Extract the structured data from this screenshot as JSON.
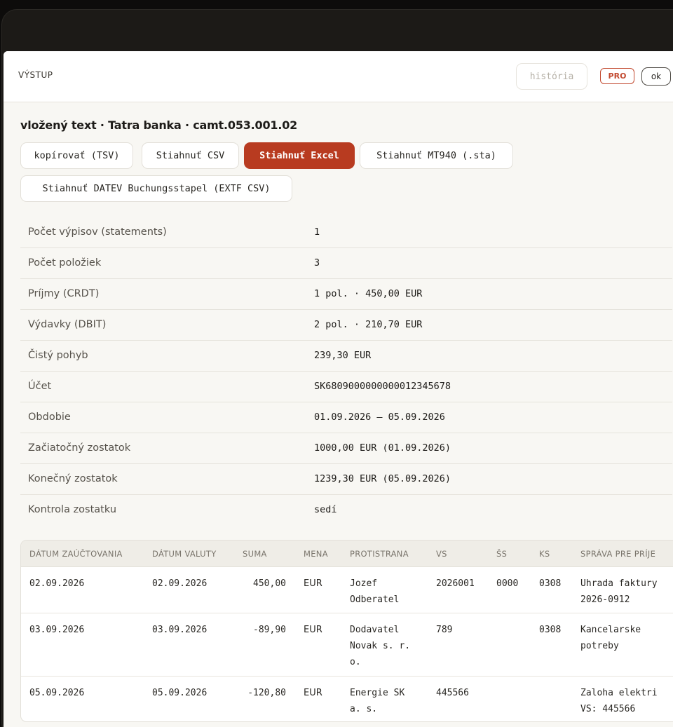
{
  "header": {
    "title": "VÝSTUP",
    "history_label": "história",
    "pro_badge": "PRO",
    "ok_label": "ok"
  },
  "source_line": "vložený text · Tatra banka · camt.053.001.02",
  "actions": {
    "copy_tsv": "kopírovať (TSV)",
    "download_csv": "Stiahnuť CSV",
    "download_excel": "Stiahnuť Excel",
    "download_mt940": "Stiahnuť MT940 (.sta)",
    "download_datev": "Stiahnuť DATEV Buchungsstapel (EXTF CSV)"
  },
  "summary": [
    {
      "label": "Počet výpisov (statements)",
      "value": "1"
    },
    {
      "label": "Počet položiek",
      "value": "3"
    },
    {
      "label": "Príjmy (CRDT)",
      "value": "1 pol. · 450,00 EUR"
    },
    {
      "label": "Výdavky (DBIT)",
      "value": "2 pol. · 210,70 EUR"
    },
    {
      "label": "Čistý pohyb",
      "value": "239,30 EUR"
    },
    {
      "label": "Účet",
      "value": "SK6809000000000012345678"
    },
    {
      "label": "Obdobie",
      "value": "01.09.2026 – 05.09.2026"
    },
    {
      "label": "Začiatočný zostatok",
      "value": "1000,00 EUR (01.09.2026)"
    },
    {
      "label": "Konečný zostatok",
      "value": "1239,30 EUR (05.09.2026)"
    },
    {
      "label": "Kontrola zostatku",
      "value": "sedí"
    }
  ],
  "table": {
    "columns": [
      "DÁTUM ZAÚČTOVANIA",
      "DÁTUM VALUTY",
      "SUMA",
      "MENA",
      "PROTISTRANA",
      "VS",
      "ŠS",
      "KS",
      "SPRÁVA PRE PRÍJE"
    ],
    "rows": [
      {
        "booking": "02.09.2026",
        "value_date": "02.09.2026",
        "amount": "450,00",
        "currency": "EUR",
        "counterparty": "Jozef\nOdberatel",
        "vs": "2026001",
        "ss": "0000",
        "ks": "0308",
        "message": "Uhrada faktury\n2026-0912"
      },
      {
        "booking": "03.09.2026",
        "value_date": "03.09.2026",
        "amount": "-89,90",
        "currency": "EUR",
        "counterparty": "Dodavatel\nNovak s. r.\no.",
        "vs": "789",
        "ss": "",
        "ks": "0308",
        "message": "Kancelarske\npotreby"
      },
      {
        "booking": "05.09.2026",
        "value_date": "05.09.2026",
        "amount": "-120,80",
        "currency": "EUR",
        "counterparty": "Energie SK\na. s.",
        "vs": "445566",
        "ss": "",
        "ks": "",
        "message": "Zaloha elektri\nVS: 445566"
      }
    ]
  }
}
